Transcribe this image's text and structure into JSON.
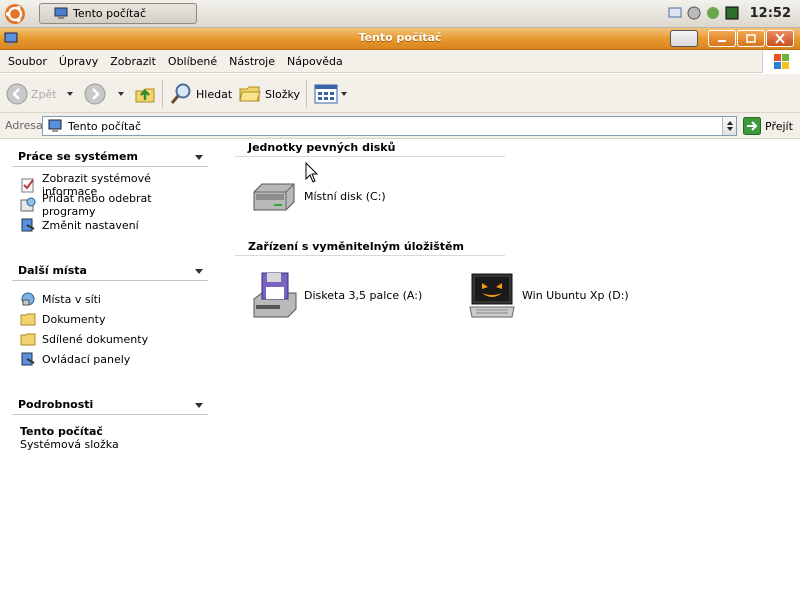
{
  "taskbar": {
    "window_button_label": "Tento počítač",
    "clock": "12:52"
  },
  "window": {
    "title": "Tento počítač"
  },
  "menu": {
    "items": [
      "Soubor",
      "Úpravy",
      "Zobrazit",
      "Oblíbené",
      "Nástroje",
      "Nápověda"
    ]
  },
  "toolbar": {
    "back_label": "Zpět",
    "search_label": "Hledat",
    "folders_label": "Složky"
  },
  "address": {
    "label": "Adresa",
    "value": "Tento počítač",
    "go_label": "Přejít"
  },
  "left_pane": {
    "system_tasks": {
      "title": "Práce se systémem",
      "items": [
        "Zobrazit systémové informace",
        "Přidat nebo odebrat programy",
        "Změnit nastavení"
      ]
    },
    "other_places": {
      "title": "Další místa",
      "items": [
        "Místa v síti",
        "Dokumenty",
        "Sdílené dokumenty",
        "Ovládací panely"
      ]
    },
    "details": {
      "title": "Podrobnosti",
      "name": "Tento počítač",
      "type": "Systémová složka"
    }
  },
  "main": {
    "hard_disks": {
      "title": "Jednotky pevných disků",
      "items": [
        "Místní disk (C:)"
      ]
    },
    "removable": {
      "title": "Zařízení s vyměnitelným úložištěm",
      "items": [
        "Disketa 3,5 palce (A:)",
        "Win Ubuntu Xp (D:)"
      ]
    }
  },
  "colors": {
    "title_bar": "#e89a2e",
    "pane_text": "#000000"
  }
}
